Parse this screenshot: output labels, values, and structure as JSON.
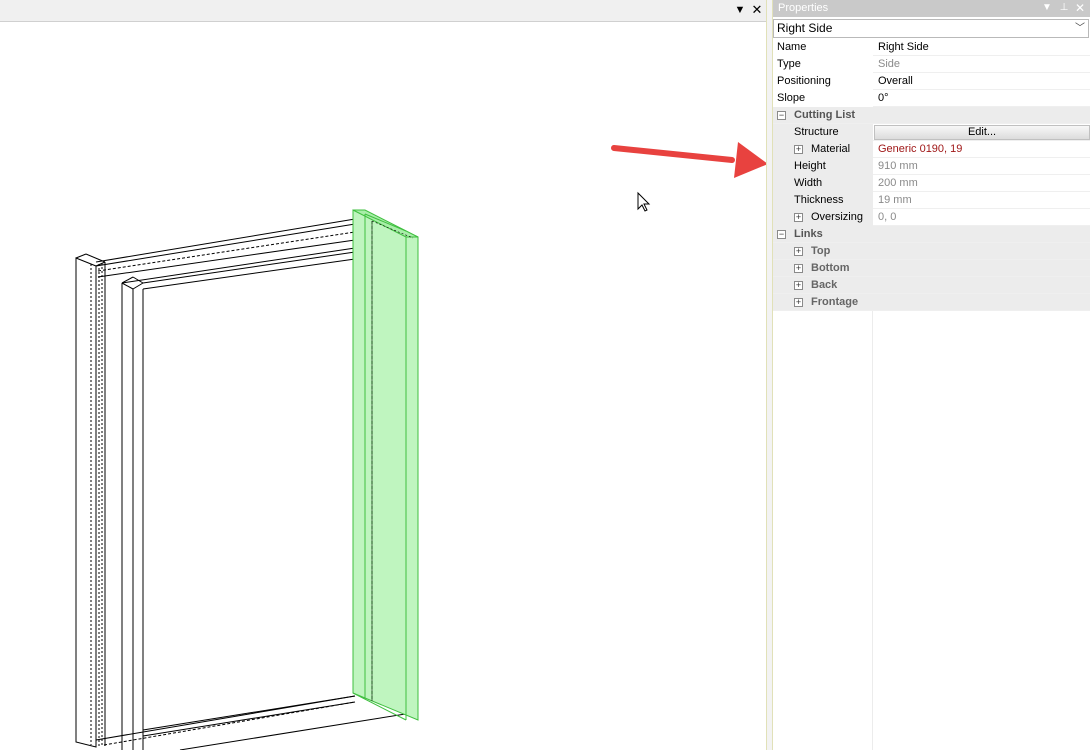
{
  "viewport": {
    "dropdown_icon": "chevron-down-icon",
    "close_icon": "close-icon"
  },
  "panel": {
    "title": "Properties",
    "selector_value": "Right Side",
    "rows": {
      "name": {
        "label": "Name",
        "value": "Right Side"
      },
      "type": {
        "label": "Type",
        "value": "Side"
      },
      "positioning": {
        "label": "Positioning",
        "value": "Overall"
      },
      "slope": {
        "label": "Slope",
        "value": "0°"
      },
      "cutting_list": {
        "label": "Cutting List"
      },
      "structure": {
        "label": "Structure",
        "button": "Edit..."
      },
      "material": {
        "label": "Material",
        "value": "Generic 0190, 19"
      },
      "height": {
        "label": "Height",
        "value": "910 mm"
      },
      "width": {
        "label": "Width",
        "value": "200 mm"
      },
      "thickness": {
        "label": "Thickness",
        "value": "19 mm"
      },
      "oversizing": {
        "label": "Oversizing",
        "value": "0, 0"
      },
      "links": {
        "label": "Links"
      },
      "top": {
        "label": "Top"
      },
      "bottom": {
        "label": "Bottom"
      },
      "back": {
        "label": "Back"
      },
      "frontage": {
        "label": "Frontage"
      }
    }
  },
  "colors": {
    "highlight_panel": "#bff5bf",
    "highlight_stroke": "#3fbf3f",
    "annotation_arrow": "#e8423f",
    "material_value": "#a01818"
  }
}
